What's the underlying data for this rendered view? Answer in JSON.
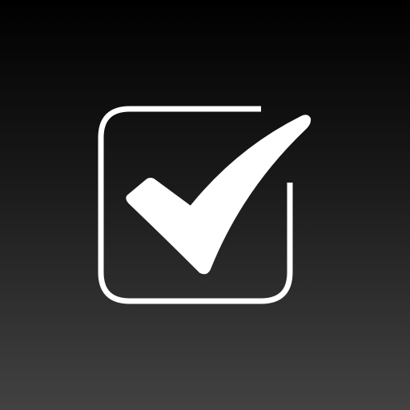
{
  "app_icon": {
    "icon": "checkbox-checked-icon",
    "colors": {
      "background_top": "#000000",
      "background_bottom": "#424242",
      "glyph": "#ffffff"
    }
  }
}
